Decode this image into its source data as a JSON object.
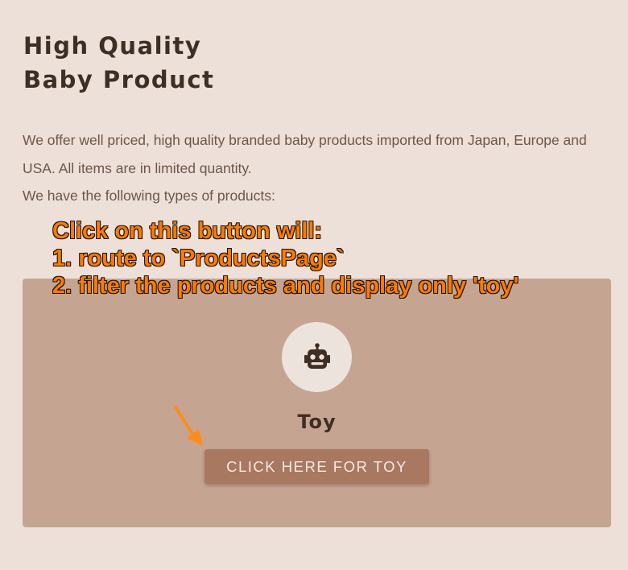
{
  "hero": {
    "title_line1": "High Quality",
    "title_line2": "Baby Product"
  },
  "description": {
    "line1": "We offer well priced, high quality branded baby products imported from Japan, Europe and USA. All items are in limited quantity.",
    "line2": "We have the following types of products:"
  },
  "category_card": {
    "icon": "robot-icon",
    "title": "Toy",
    "button_label": "Click here for toy"
  },
  "annotation": {
    "line1": "Click on this button will:",
    "line2": "1. route to `ProductsPage`",
    "line3": "2. filter the products and display only 'toy'"
  },
  "colors": {
    "background": "#ece0d8",
    "card": "#c5a592",
    "button": "#a97861",
    "annotation": "#ff7a00",
    "heading": "#3f2e23"
  }
}
